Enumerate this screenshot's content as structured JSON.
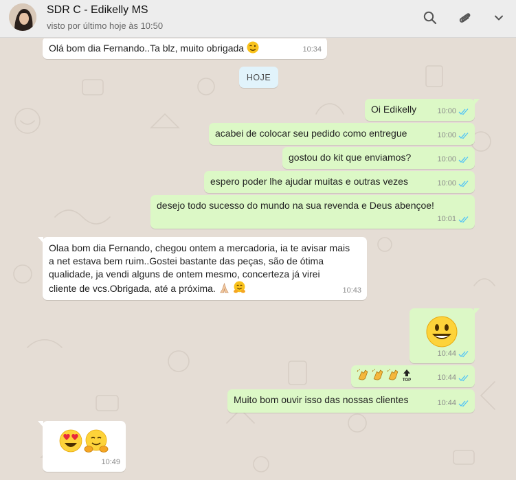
{
  "header": {
    "contact_name": "SDR C - Edikelly MS",
    "status": "visto por último hoje às 10:50",
    "icons": [
      "search-icon",
      "attach-icon",
      "chevron-down-icon"
    ]
  },
  "date_divider": "HOJE",
  "messages": [
    {
      "dir": "in",
      "text": "Olá  bom dia Fernando..Ta blz, muito obrigada",
      "emoji": "wink",
      "time": "10:34"
    },
    {
      "dir": "out",
      "text": "Oi Edikelly",
      "time": "10:00",
      "read": true
    },
    {
      "dir": "out",
      "text": "acabei de colocar seu pedido como entregue",
      "time": "10:00",
      "read": true
    },
    {
      "dir": "out",
      "text": "gostou do kit que enviamos?",
      "time": "10:00",
      "read": true
    },
    {
      "dir": "out",
      "text": "espero poder lhe ajudar muitas e outras vezes",
      "time": "10:00",
      "read": true
    },
    {
      "dir": "out",
      "text": "desejo todo sucesso do mundo na sua revenda e Deus abençoe!",
      "time": "10:01",
      "read": true
    },
    {
      "dir": "in",
      "lines": [
        "Olaa bom dia Fernando, chegou ontem a mercadoria, ia te avisar mais",
        "a net estava bem ruim..Gostei bastante  das peças, são  de ótima",
        "qualidade, ja vendi alguns de ontem mesmo,  concerteza já  virei",
        "cliente  de vcs.Obrigada, até a próxima."
      ],
      "emoji": "pray-hug",
      "time": "10:43"
    },
    {
      "dir": "out",
      "emoji": "smiley",
      "time": "10:44",
      "read": true
    },
    {
      "dir": "out",
      "emoji": "clap-clap-clap-top",
      "time": "10:44",
      "read": true
    },
    {
      "dir": "out",
      "text": "Muito bom ouvir isso das nossas clientes",
      "time": "10:44",
      "read": true
    },
    {
      "dir": "in",
      "emoji": "heart-eyes-hug",
      "time": "10:49"
    }
  ],
  "colors": {
    "chat_bg": "#e5ddd5",
    "incoming_bubble": "#ffffff",
    "outgoing_bubble": "#dcf8c6",
    "read_ticks": "#4fc3f7",
    "header_bg": "#ededed"
  }
}
